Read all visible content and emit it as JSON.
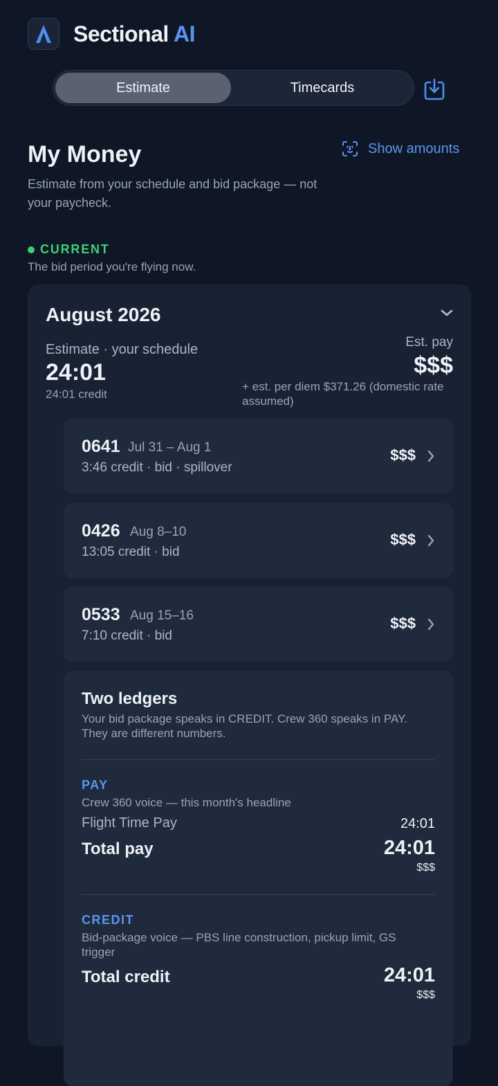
{
  "header": {
    "title_main": "Sectional",
    "title_accent": "AI"
  },
  "tabs": {
    "active_label": "Estimate",
    "inactive_label": "Timecards"
  },
  "page": {
    "title": "My Money",
    "show_amounts": "Show amounts",
    "subtitle": "Estimate from your schedule and bid package — not your paycheck."
  },
  "current": {
    "label": "CURRENT",
    "desc": "The bid period you're flying now."
  },
  "month": {
    "title": "August 2026",
    "estimate_label": "Estimate · your schedule",
    "hours": "24:01",
    "credit": "24:01 credit",
    "est_pay_label": "Est. pay",
    "est_pay_value": "$$$",
    "per_diem": "+ est. per diem $371.26 (domestic rate assumed)"
  },
  "trips": [
    {
      "number": "0641",
      "dates": "Jul 31 – Aug 1",
      "meta": "3:46 credit · bid · spillover",
      "amount": "$$$"
    },
    {
      "number": "0426",
      "dates": "Aug 8–10",
      "meta": "13:05 credit · bid",
      "amount": "$$$"
    },
    {
      "number": "0533",
      "dates": "Aug 15–16",
      "meta": "7:10 credit · bid",
      "amount": "$$$"
    }
  ],
  "ledgers": {
    "title": "Two ledgers",
    "desc": "Your bid package speaks in CREDIT. Crew 360 speaks in PAY. They are different numbers.",
    "pay": {
      "label": "PAY",
      "desc": "Crew 360 voice — this month's headline",
      "row_label": "Flight Time Pay",
      "row_value": "24:01",
      "total_label": "Total pay",
      "total_value": "24:01",
      "total_amount": "$$$"
    },
    "credit": {
      "label": "CREDIT",
      "desc": "Bid-package voice — PBS line construction, pickup limit, GS trigger",
      "total_label": "Total credit",
      "total_value": "24:01",
      "total_amount": "$$$"
    }
  },
  "colors": {
    "background": "#0f1726",
    "card": "#182233",
    "accent": "#5b95ee",
    "green": "#3ecf76"
  }
}
